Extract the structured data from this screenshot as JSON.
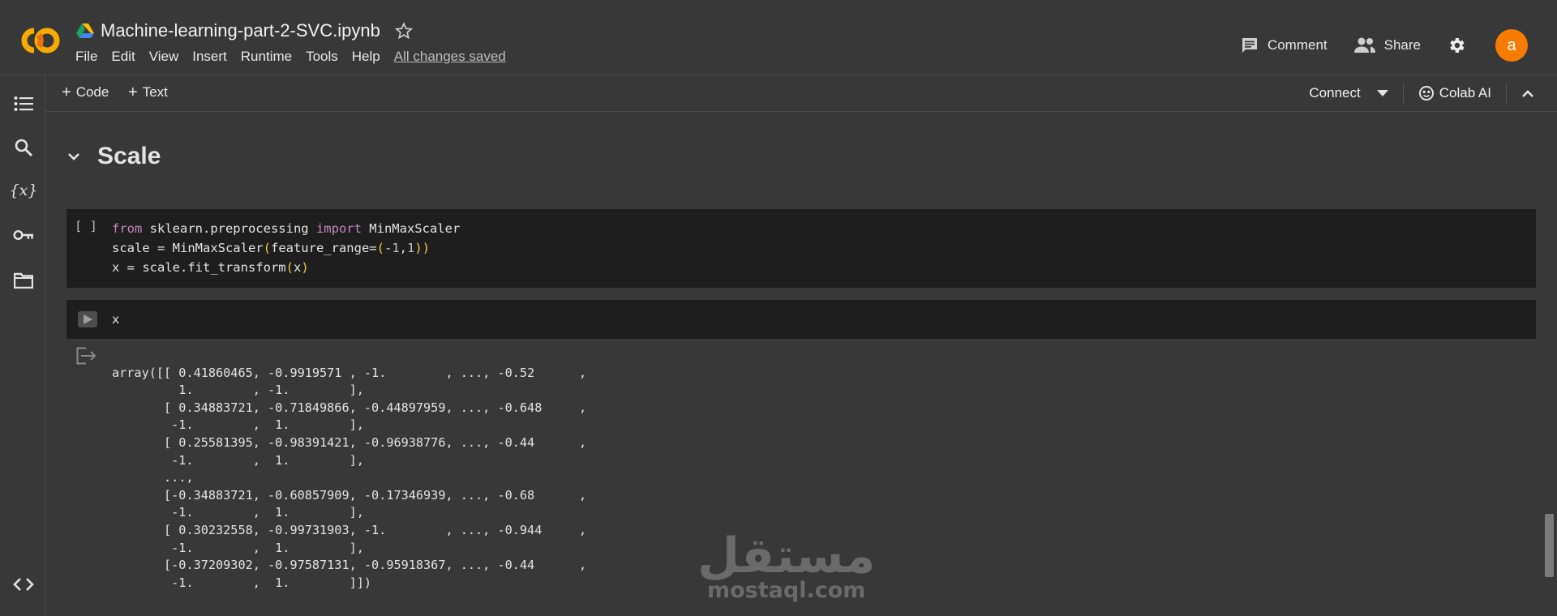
{
  "app": {
    "notebook_title": "Machine-learning-part-2-SVC.ipynb",
    "menu": [
      "File",
      "Edit",
      "View",
      "Insert",
      "Runtime",
      "Tools",
      "Help"
    ],
    "save_status": "All changes saved",
    "comment_label": "Comment",
    "share_label": "Share",
    "avatar_letter": "a",
    "accent_color": "#f57c00"
  },
  "toolbar": {
    "code_label": "Code",
    "text_label": "Text",
    "connect_label": "Connect",
    "colab_ai_label": "Colab AI"
  },
  "section": {
    "title": "Scale"
  },
  "cell1": {
    "run_marker": "[ ]",
    "lines": [
      "from sklearn.preprocessing import MinMaxScaler",
      "scale = MinMaxScaler(feature_range=(-1,1))",
      "x = scale.fit_transform(x)"
    ]
  },
  "cell2": {
    "code": "x",
    "output_lines": [
      "array([[ 0.41860465, -0.9919571 , -1.        , ..., -0.52      ,",
      "         1.        , -1.        ],",
      "       [ 0.34883721, -0.71849866, -0.44897959, ..., -0.648     ,",
      "        -1.        ,  1.        ],",
      "       [ 0.25581395, -0.98391421, -0.96938776, ..., -0.44      ,",
      "        -1.        ,  1.        ],",
      "       ...,",
      "       [-0.34883721, -0.60857909, -0.17346939, ..., -0.68      ,",
      "        -1.        ,  1.        ],",
      "       [ 0.30232558, -0.99731903, -1.        , ..., -0.944     ,",
      "        -1.        ,  1.        ],",
      "       [-0.37209302, -0.97587131, -0.95918367, ..., -0.44      ,",
      "        -1.        ,  1.        ]])"
    ]
  },
  "watermark": {
    "arabic": "مستقل",
    "latin": "mostaql.com"
  }
}
